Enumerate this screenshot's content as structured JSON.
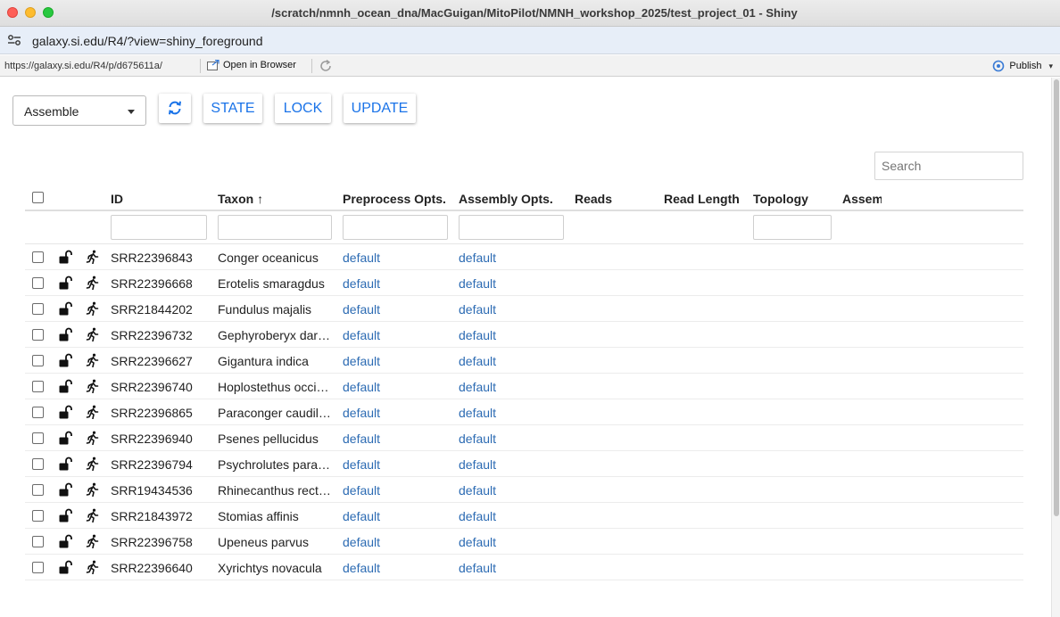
{
  "window": {
    "title": "/scratch/nmnh_ocean_dna/MacGuigan/MitoPilot/NMNH_workshop_2025/test_project_01 - Shiny"
  },
  "urlbar": {
    "url": "galaxy.si.edu/R4/?view=shiny_foreground"
  },
  "toolbar": {
    "url": "https://galaxy.si.edu/R4/p/d675611a/",
    "open_browser": "Open in Browser",
    "publish": "Publish"
  },
  "controls": {
    "select_value": "Assemble",
    "state_label": "STATE",
    "lock_label": "LOCK",
    "update_label": "UPDATE",
    "search_placeholder": "Search"
  },
  "colors": {
    "accent": "#1a73e8",
    "link": "#2c6bb3"
  },
  "table": {
    "columns": [
      "ID",
      "Taxon ↑",
      "Preprocess Opts.",
      "Assembly Opts.",
      "Reads",
      "Read Length",
      "Topology",
      "Assem"
    ],
    "rows": [
      {
        "id": "SRR22396843",
        "taxon": "Conger oceanicus",
        "preprocess": "default",
        "assembly": "default"
      },
      {
        "id": "SRR22396668",
        "taxon": "Erotelis smaragdus",
        "preprocess": "default",
        "assembly": "default"
      },
      {
        "id": "SRR21844202",
        "taxon": "Fundulus majalis",
        "preprocess": "default",
        "assembly": "default"
      },
      {
        "id": "SRR22396732",
        "taxon": "Gephyroberyx dar…",
        "preprocess": "default",
        "assembly": "default"
      },
      {
        "id": "SRR22396627",
        "taxon": "Gigantura indica",
        "preprocess": "default",
        "assembly": "default"
      },
      {
        "id": "SRR22396740",
        "taxon": "Hoplostethus occi…",
        "preprocess": "default",
        "assembly": "default"
      },
      {
        "id": "SRR22396865",
        "taxon": "Paraconger caudil…",
        "preprocess": "default",
        "assembly": "default"
      },
      {
        "id": "SRR22396940",
        "taxon": "Psenes pellucidus",
        "preprocess": "default",
        "assembly": "default"
      },
      {
        "id": "SRR22396794",
        "taxon": "Psychrolutes para…",
        "preprocess": "default",
        "assembly": "default"
      },
      {
        "id": "SRR19434536",
        "taxon": "Rhinecanthus rect…",
        "preprocess": "default",
        "assembly": "default"
      },
      {
        "id": "SRR21843972",
        "taxon": "Stomias affinis",
        "preprocess": "default",
        "assembly": "default"
      },
      {
        "id": "SRR22396758",
        "taxon": "Upeneus parvus",
        "preprocess": "default",
        "assembly": "default"
      },
      {
        "id": "SRR22396640",
        "taxon": "Xyrichtys novacula",
        "preprocess": "default",
        "assembly": "default"
      }
    ]
  }
}
